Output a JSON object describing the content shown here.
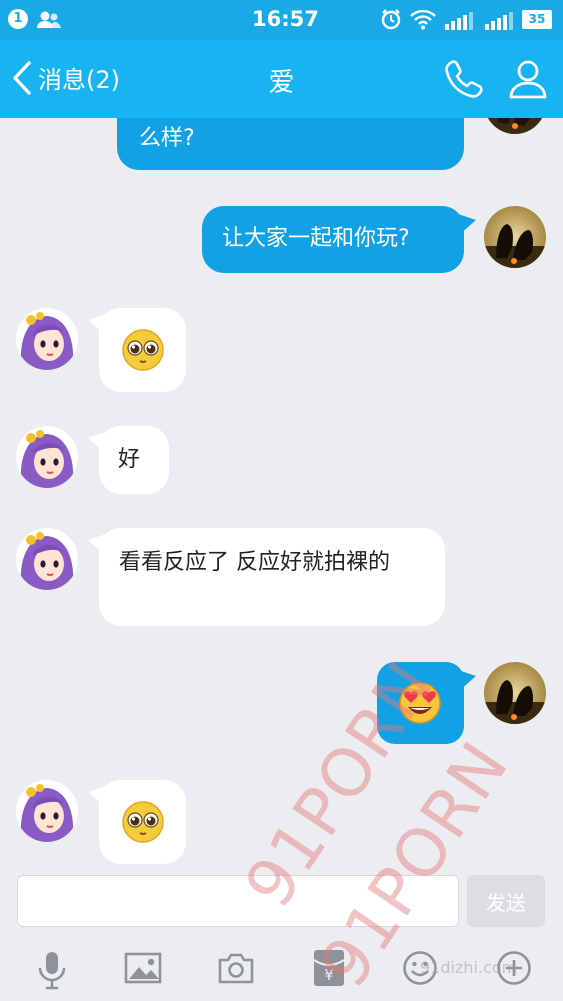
{
  "status_bar": {
    "notification_count": "1",
    "time": "16:57",
    "battery": "35"
  },
  "nav": {
    "back_label": "消息(2)",
    "title": "爱"
  },
  "messages": [
    {
      "direction": "out",
      "text": "么样?"
    },
    {
      "direction": "out",
      "text": "让大家一起和你玩?"
    },
    {
      "direction": "in",
      "emoji": "innocent-face"
    },
    {
      "direction": "in",
      "text": "好"
    },
    {
      "direction": "in",
      "text": "看看反应了  反应好就拍裸的"
    },
    {
      "direction": "out",
      "emoji": "heart-eyes-face"
    },
    {
      "direction": "in",
      "emoji": "innocent-face"
    }
  ],
  "input": {
    "value": "",
    "send_label": "发送"
  },
  "toolbar": [
    "mic-icon",
    "image-icon",
    "camera-icon",
    "red-packet-icon",
    "emoji-icon",
    "plus-icon"
  ],
  "colors": {
    "status_bar": "#18a9e6",
    "nav_bar": "#18b4f1",
    "outgoing_bubble": "#13a1e5",
    "incoming_bubble": "#ffffff",
    "background": "#ecedf0",
    "watermark": "#e47878"
  },
  "watermark": {
    "primary": "91PORN",
    "secondary": "91PORN",
    "domain": "91dizhi.com"
  }
}
